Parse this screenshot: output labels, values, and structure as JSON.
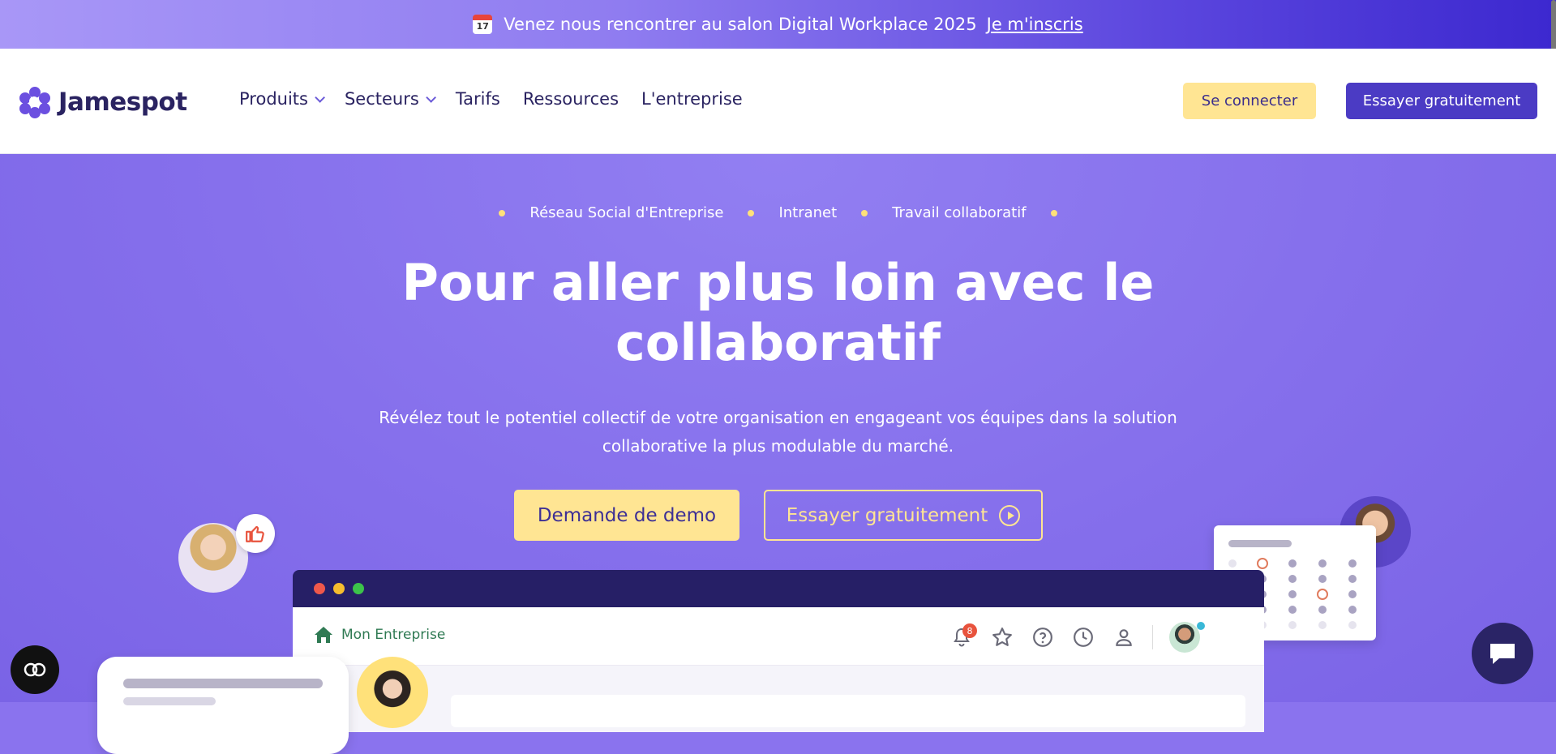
{
  "announcement": {
    "calendar_day": "17",
    "text": "Venez nous rencontrer au salon Digital Workplace 2025",
    "link": "Je m'inscris"
  },
  "header": {
    "logo_text": "Jamespot",
    "nav": [
      {
        "label": "Produits",
        "has_dropdown": true
      },
      {
        "label": "Secteurs",
        "has_dropdown": true
      },
      {
        "label": "Tarifs",
        "has_dropdown": false
      },
      {
        "label": "Ressources",
        "has_dropdown": false
      },
      {
        "label": "L'entreprise",
        "has_dropdown": false
      }
    ],
    "login_label": "Se connecter",
    "try_label": "Essayer gratuitement"
  },
  "hero": {
    "tags": [
      "Réseau Social d'Entreprise",
      "Intranet",
      "Travail collaboratif"
    ],
    "title": "Pour aller plus loin avec le collaboratif",
    "subtitle": "Révélez tout le potentiel collectif de votre organisation en engageant vos équipes dans la solution collaborative la plus modulable du marché.",
    "demo_label": "Demande de demo",
    "try_label": "Essayer gratuitement"
  },
  "app_mockup": {
    "home_label": "Mon Entreprise",
    "notification_count": "8"
  },
  "colors": {
    "primary": "#4b3bc4",
    "accent_yellow": "#ffe593",
    "hero_bg": "#8a73ee",
    "dark_navy": "#261f66"
  },
  "icons": [
    "calendar-icon",
    "chevron-down-icon",
    "play-circle-icon",
    "home-icon",
    "bell-icon",
    "star-icon",
    "help-icon",
    "clock-icon",
    "user-icon",
    "thumbs-up-icon",
    "cookie-settings-icon",
    "chat-icon"
  ]
}
